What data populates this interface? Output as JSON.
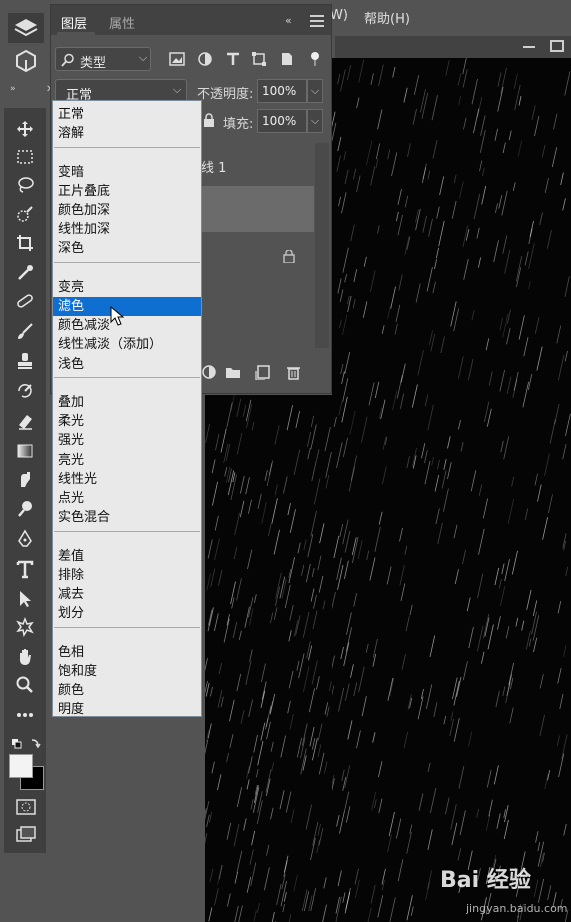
{
  "menubar": {
    "partial_item": "W)",
    "help": "帮助(H)"
  },
  "layers_panel": {
    "tabs": [
      {
        "label": "图层"
      },
      {
        "label": "属性"
      }
    ],
    "collapse_label": "«",
    "filter": {
      "label": "类型"
    },
    "blend_mode": "正常",
    "opacity": {
      "label": "不透明度:",
      "value": "100%"
    },
    "fill": {
      "label": "填充:",
      "value": "100%"
    },
    "layer_name_partial": "线 1"
  },
  "blend_dropdown": {
    "groups": [
      [
        "正常",
        "溶解"
      ],
      [
        "变暗",
        "正片叠底",
        "颜色加深",
        "线性加深",
        "深色"
      ],
      [
        "变亮",
        "滤色",
        "颜色减淡",
        "线性减淡（添加）",
        "浅色"
      ],
      [
        "叠加",
        "柔光",
        "强光",
        "亮光",
        "线性光",
        "点光",
        "实色混合"
      ],
      [
        "差值",
        "排除",
        "减去",
        "划分"
      ],
      [
        "色相",
        "饱和度",
        "颜色",
        "明度"
      ]
    ],
    "highlighted": "滤色"
  },
  "watermark": {
    "logo": "Bai 经验",
    "url": "jingyan.baidu.com"
  }
}
